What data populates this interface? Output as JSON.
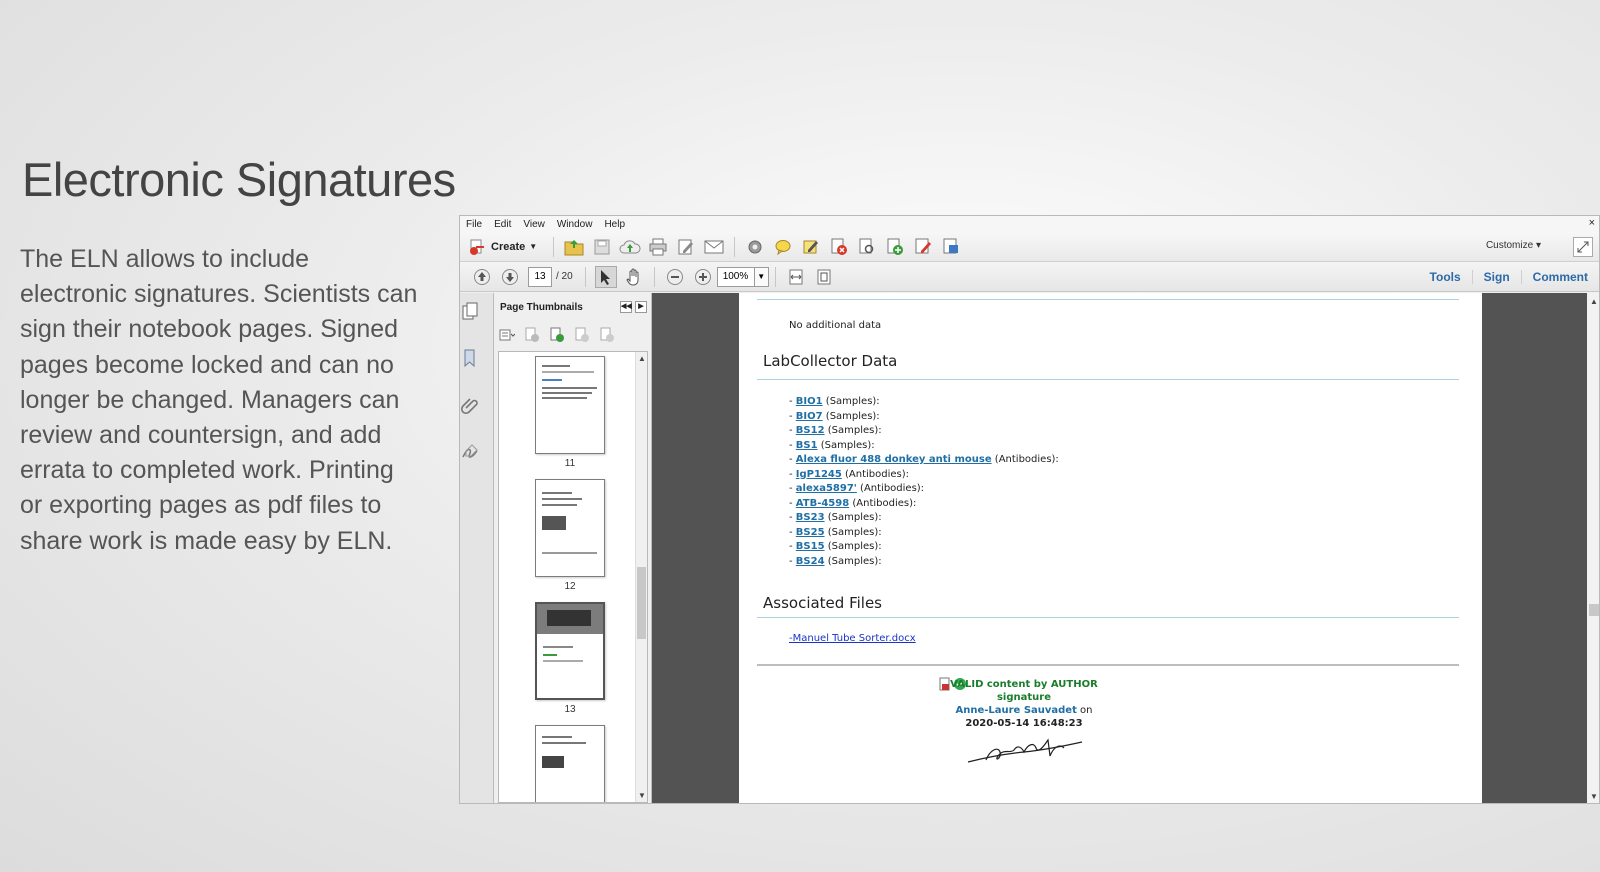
{
  "headline": "Electronic Signatures",
  "blurb": "The ELN allows to include electronic signatures.  Scientists can sign their notebook pages.  Signed pages become locked and can no longer be changed. Managers can review and countersign, and add errata to completed work. Printing or exporting pages as pdf files to share work is made easy by ELN.",
  "window": {
    "menu": [
      "File",
      "Edit",
      "View",
      "Window",
      "Help"
    ],
    "close_glyph": "×",
    "toolbar": {
      "create_label": "Create",
      "customize_label": "Customize"
    },
    "nav": {
      "current_page": "13",
      "total_pages": "/ 20",
      "zoom": "100%"
    },
    "right_tabs": [
      "Tools",
      "Sign",
      "Comment"
    ],
    "thumbnails": {
      "title": "Page Thumbnails",
      "pages": [
        "11",
        "12",
        "13"
      ]
    }
  },
  "document": {
    "no_additional_data": "No additional data",
    "labcollector_title": "LabCollector Data",
    "items": [
      {
        "link": "BIO1",
        "type": "(Samples):"
      },
      {
        "link": "BIO7",
        "type": "(Samples):"
      },
      {
        "link": "BS12",
        "type": "(Samples):"
      },
      {
        "link": "BS1",
        "type": "(Samples):"
      },
      {
        "link": "Alexa fluor 488 donkey anti mouse",
        "type": "(Antibodies):"
      },
      {
        "link": "IgP1245",
        "type": "(Antibodies):"
      },
      {
        "link": "alexa5897'",
        "type": "(Antibodies):"
      },
      {
        "link": "ATB-4598",
        "type": "(Antibodies):"
      },
      {
        "link": "BS23",
        "type": "(Samples):"
      },
      {
        "link": "BS25",
        "type": "(Samples):"
      },
      {
        "link": "BS15",
        "type": "(Samples):"
      },
      {
        "link": "BS24",
        "type": "(Samples):"
      }
    ],
    "associated_files_title": "Associated Files",
    "file_link": "-Manuel Tube Sorter.docx",
    "signature": {
      "line1": "VALID content by AUTHOR",
      "line2": "signature",
      "author": "Anne-Laure Sauvadet",
      "on": " on",
      "timestamp": "2020-05-14 16:48:23"
    }
  }
}
